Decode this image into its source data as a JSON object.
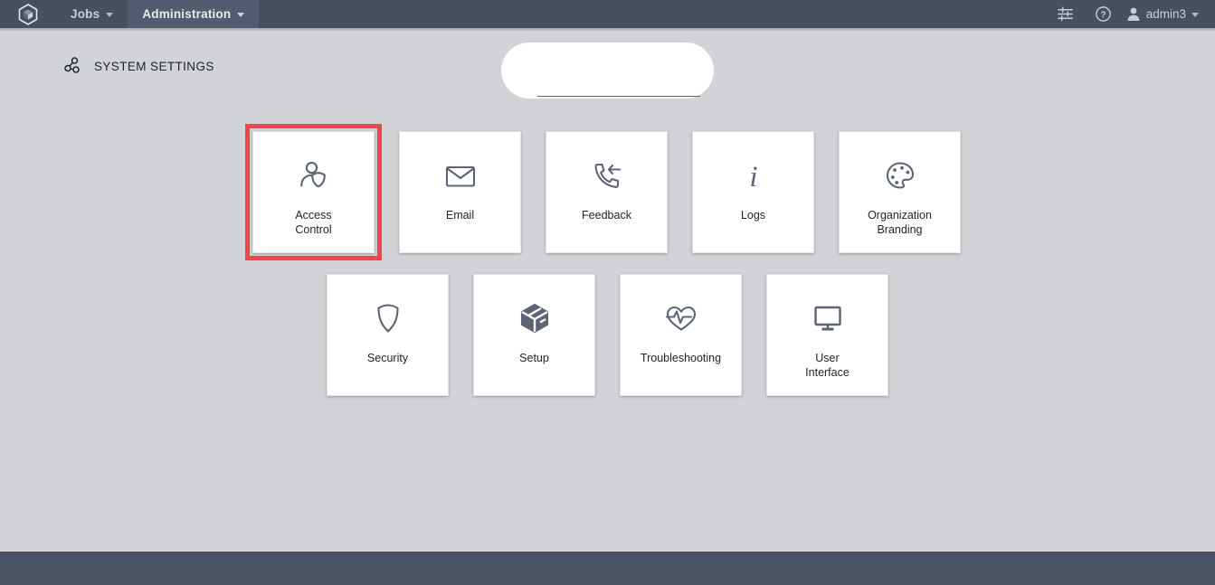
{
  "topbar": {
    "logo_icon": "hexagon-cube-logo-icon",
    "nav": [
      {
        "label": "Jobs",
        "active": false,
        "has_caret": true
      },
      {
        "label": "Administration",
        "active": true,
        "has_caret": true
      }
    ],
    "actions": [
      {
        "icon": "sliders-settings-icon",
        "name": "preferences-icon"
      },
      {
        "icon": "help-circle-icon",
        "name": "help-icon"
      }
    ],
    "user": {
      "name": "admin3",
      "avatar_icon": "user-avatar-icon",
      "has_caret": true
    }
  },
  "page": {
    "header_icon": "hierarchy-nodes-icon",
    "title": "SYSTEM SETTINGS"
  },
  "filter": {
    "icon": "funnel-filter-icon",
    "value": "",
    "placeholder": ""
  },
  "colors": {
    "navbar": "#474f63",
    "navbar_active": "#535b70",
    "page_bg": "#d2d3d6",
    "tile_bg": "#ffffff",
    "icon": "#5d6474",
    "highlight": "#f4434a",
    "footer": "#4a5266"
  },
  "tiles": {
    "row1": [
      {
        "label": "Access\nControl",
        "icon": "user-shield-icon",
        "highlighted": true
      },
      {
        "label": "Email",
        "icon": "envelope-icon",
        "highlighted": false
      },
      {
        "label": "Feedback",
        "icon": "phone-return-icon",
        "highlighted": false
      },
      {
        "label": "Logs",
        "icon": "info-italic-icon",
        "highlighted": false
      },
      {
        "label": "Organization\nBranding",
        "icon": "paint-palette-icon",
        "highlighted": false
      }
    ],
    "row2": [
      {
        "label": "Security",
        "icon": "shield-icon",
        "highlighted": false
      },
      {
        "label": "Setup",
        "icon": "cube-box-icon",
        "highlighted": false
      },
      {
        "label": "Troubleshooting",
        "icon": "heart-pulse-icon",
        "highlighted": false
      },
      {
        "label": "User\nInterface",
        "icon": "monitor-icon",
        "highlighted": false
      }
    ]
  }
}
